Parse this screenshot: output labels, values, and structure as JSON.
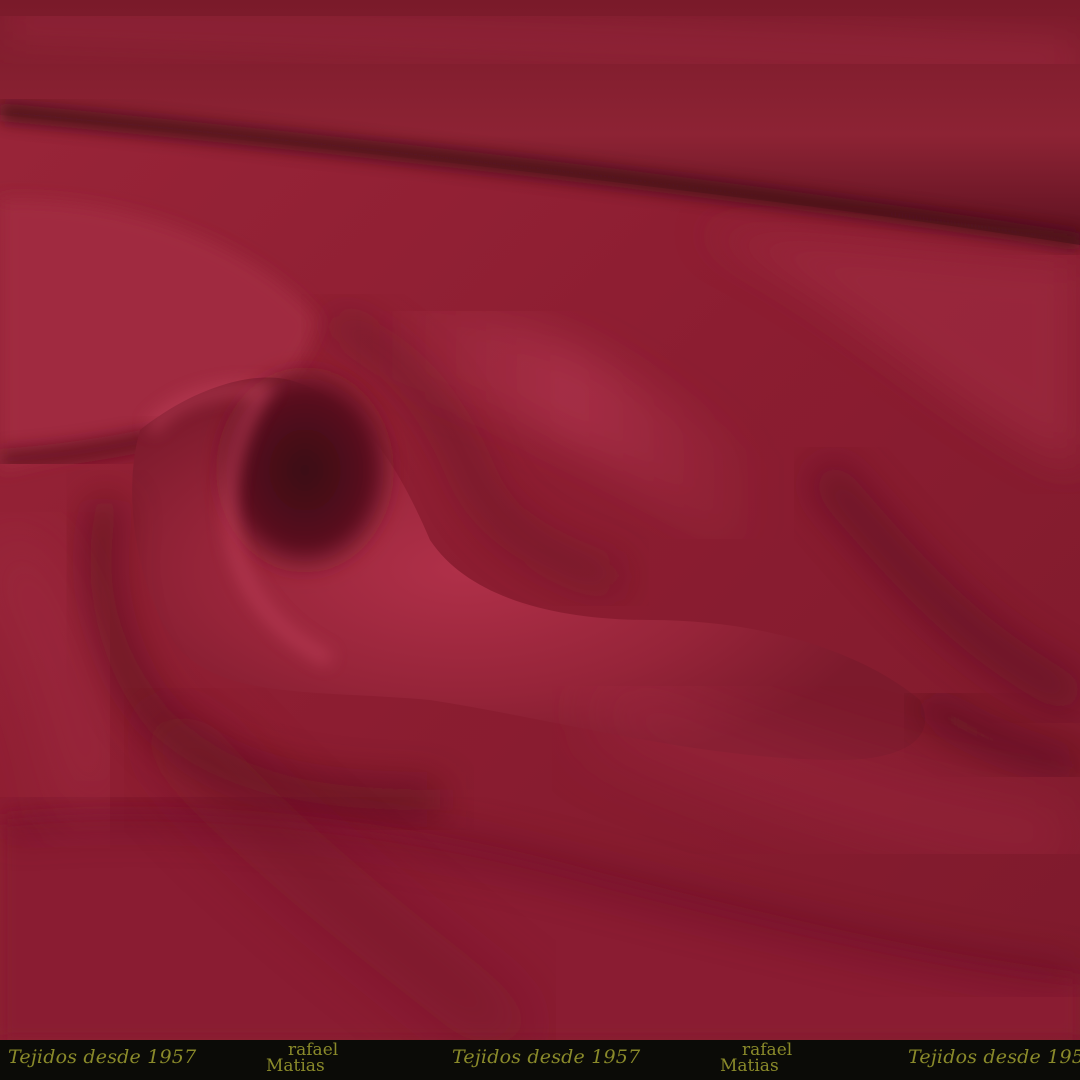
{
  "footer": {
    "tagline": "Tejidos desde 1957",
    "logo_line1": "rafael",
    "logo_line2": "Matias"
  },
  "colors": {
    "fabric_base": "#8e1f33",
    "fabric_highlight": "#b8344f",
    "fabric_shadow": "#4a0c18",
    "footer_bg": "#0b0b07",
    "footer_text": "#8a8a2a"
  }
}
